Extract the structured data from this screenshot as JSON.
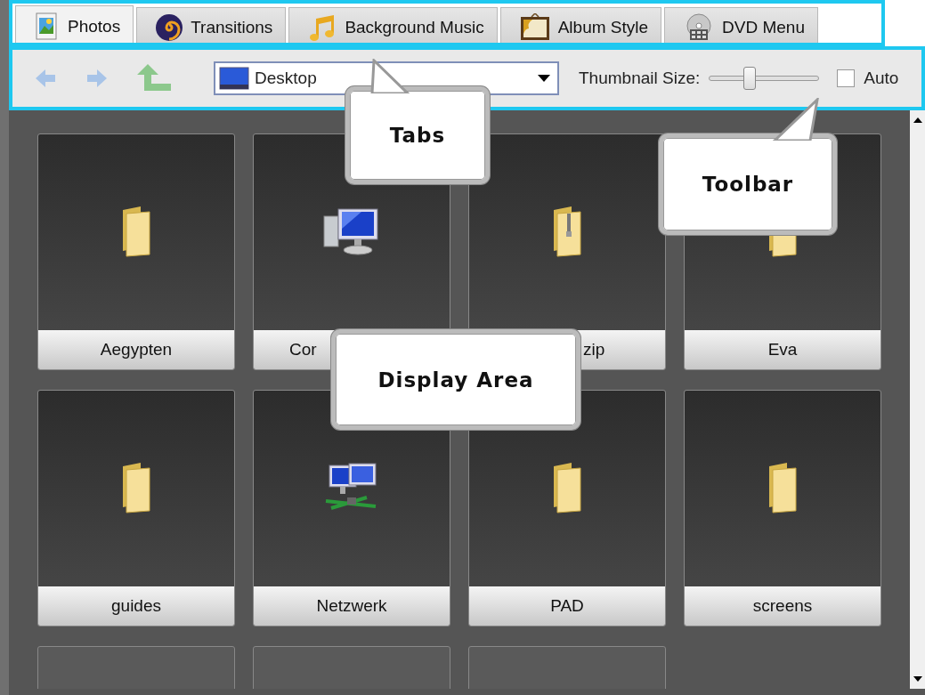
{
  "tabs": [
    {
      "label": "Photos",
      "selected": true
    },
    {
      "label": "Transitions",
      "selected": false
    },
    {
      "label": "Background Music",
      "selected": false
    },
    {
      "label": "Album Style",
      "selected": false
    },
    {
      "label": "DVD Menu",
      "selected": false
    }
  ],
  "toolbar": {
    "location": "Desktop",
    "thumbnail_size_label": "Thumbnail Size:",
    "thumbnail_size": {
      "level": 0.37
    },
    "auto": {
      "label": "Auto",
      "checked": false
    }
  },
  "items": [
    {
      "label": "Aegypten",
      "kind": "folder"
    },
    {
      "label": "Cor",
      "kind": "computer"
    },
    {
      "label": "zip",
      "kind": "zip"
    },
    {
      "label": "Eva",
      "kind": "folder"
    },
    {
      "label": "guides",
      "kind": "folder"
    },
    {
      "label": "Netzwerk",
      "kind": "network"
    },
    {
      "label": "PAD",
      "kind": "folder"
    },
    {
      "label": "screens",
      "kind": "folder"
    },
    {
      "kind": "blank"
    },
    {
      "kind": "blank"
    },
    {
      "kind": "blank"
    }
  ],
  "callouts": [
    {
      "text": "Tabs"
    },
    {
      "text": "Toolbar"
    },
    {
      "text": "Display Area"
    }
  ]
}
